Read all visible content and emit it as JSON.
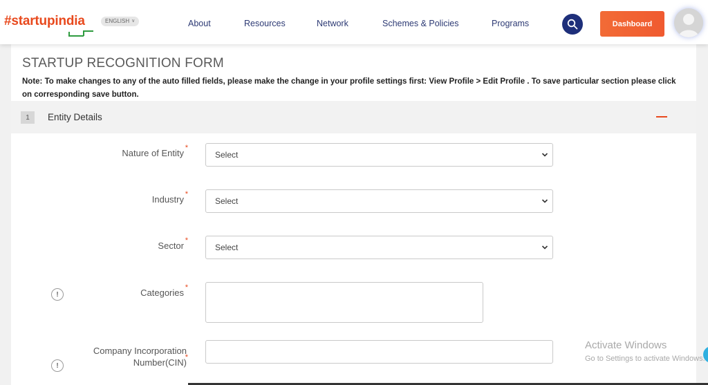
{
  "header": {
    "logo_hash": "#startup",
    "logo_india": "india",
    "language": "ENGLISH",
    "nav": [
      "About",
      "Resources",
      "Network",
      "Schemes & Policies",
      "Programs"
    ],
    "dashboard_label": "Dashboard",
    "icons": {
      "search": "search-icon",
      "avatar": "user-avatar-icon"
    }
  },
  "form": {
    "title": "STARTUP RECOGNITION FORM",
    "note": "Note: To make changes to any of the auto filled fields, please make the change in your profile settings first: View Profile > Edit Profile . To save particular section please click on corresponding save button.",
    "section": {
      "number": "1",
      "title": "Entity Details"
    },
    "fields": {
      "nature_of_entity": {
        "label": "Nature of Entity",
        "required": "*",
        "value": "Select"
      },
      "industry": {
        "label": "Industry",
        "required": "*",
        "value": "Select"
      },
      "sector": {
        "label": "Sector",
        "required": "*",
        "value": "Select"
      },
      "categories": {
        "label": "Categories",
        "required": "*",
        "info": "!"
      },
      "cin": {
        "label_line1": "Company Incorporation",
        "label_line2": "Number(CIN)",
        "required": "*",
        "info": "!"
      }
    }
  },
  "watermark": {
    "title": "Activate Windows",
    "subtitle": "Go to Settings to activate Windows."
  },
  "colors": {
    "brand_orange": "#e8491d",
    "nav_blue": "#2d3a74",
    "search_bg": "#1e2f7a",
    "dashboard_bg": "#f26b36"
  }
}
